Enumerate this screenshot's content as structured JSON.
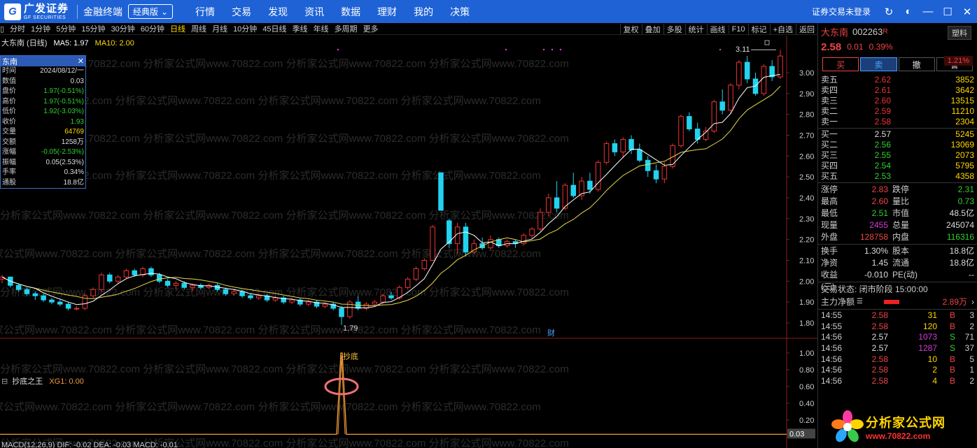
{
  "topbar": {
    "logo_cn": "广发证券",
    "logo_en": "GF SECURITIES",
    "app_name": "金融终端",
    "edition": "经典版",
    "nav": [
      "行情",
      "交易",
      "发现",
      "资讯",
      "数据",
      "理财",
      "我的",
      "决策"
    ],
    "login_status": "证券交易未登录"
  },
  "periodbar": {
    "periods": [
      "分时",
      "1分钟",
      "5分钟",
      "15分钟",
      "30分钟",
      "60分钟",
      "日线",
      "周线",
      "月线",
      "10分钟",
      "45日线",
      "季线",
      "年线",
      "多周期",
      "更多"
    ],
    "active": "日线",
    "tools": [
      "复权",
      "叠加",
      "多股",
      "统计",
      "画线",
      "F10",
      "标记",
      "+自选",
      "返回"
    ]
  },
  "chart_title": {
    "name": "大东南 (日线)",
    "ma5": "MA5: 1.97",
    "ma10": "MA10: 2.00"
  },
  "info_panel": {
    "title": "东南",
    "rows": [
      {
        "label": "时间",
        "value": "2024/08/12/一"
      },
      {
        "label": "数值",
        "value": "0.03"
      },
      {
        "label": "盘价",
        "value": "1.97(-0.51%)"
      },
      {
        "label": "高价",
        "value": "1.97(-0.51%)"
      },
      {
        "label": "低价",
        "value": "1.92(-3.03%)"
      },
      {
        "label": "收价",
        "value": "1.93"
      },
      {
        "label": "交量",
        "value": "64769"
      },
      {
        "label": "交额",
        "value": "1258万"
      },
      {
        "label": "涨幅",
        "value": "-0.05(-2.53%)"
      },
      {
        "label": "振幅",
        "value": "0.05(2.53%)"
      },
      {
        "label": "手率",
        "value": "0.34%"
      },
      {
        "label": "通股",
        "value": "18.8亿"
      }
    ]
  },
  "chart_data": [
    {
      "type": "candlestick",
      "title": "大东南 (日线)",
      "y_ticks": [
        3.0,
        2.9,
        2.8,
        2.7,
        2.6,
        2.5,
        2.4,
        2.3,
        2.2,
        2.1,
        2.0,
        1.9,
        1.8
      ],
      "ylim": [
        1.75,
        3.11
      ],
      "annotations": {
        "high_label": "3.11",
        "low_label": "1.79",
        "marker": "财"
      },
      "candles": [
        [
          2.01,
          2.03,
          1.99,
          2.02
        ],
        [
          2.02,
          2.02,
          1.97,
          1.98
        ],
        [
          1.98,
          1.99,
          1.95,
          1.96
        ],
        [
          1.96,
          1.97,
          1.93,
          1.94
        ],
        [
          1.94,
          1.95,
          1.91,
          1.93
        ],
        [
          1.93,
          1.94,
          1.9,
          1.91
        ],
        [
          1.91,
          1.92,
          1.89,
          1.9
        ],
        [
          1.9,
          1.91,
          1.88,
          1.89
        ],
        [
          1.89,
          1.9,
          1.86,
          1.87
        ],
        [
          1.87,
          1.88,
          1.86,
          1.87
        ],
        [
          1.87,
          1.94,
          1.86,
          1.93
        ],
        [
          1.93,
          1.97,
          1.92,
          1.96
        ],
        [
          1.96,
          2.04,
          1.95,
          2.03
        ],
        [
          2.03,
          2.04,
          1.99,
          2.0
        ],
        [
          2.0,
          2.03,
          1.99,
          2.02
        ],
        [
          2.02,
          2.06,
          2.01,
          2.05
        ],
        [
          2.05,
          2.06,
          2.02,
          2.03
        ],
        [
          2.03,
          2.07,
          2.02,
          2.06
        ],
        [
          2.06,
          2.07,
          2.02,
          2.03
        ],
        [
          2.03,
          2.04,
          1.99,
          2.0
        ],
        [
          2.0,
          2.01,
          1.97,
          1.98
        ],
        [
          1.98,
          2.0,
          1.96,
          1.99
        ],
        [
          1.99,
          2.0,
          1.96,
          1.97
        ],
        [
          1.97,
          1.99,
          1.95,
          1.98
        ],
        [
          1.98,
          1.99,
          1.96,
          1.97
        ],
        [
          1.97,
          1.99,
          1.96,
          1.98
        ],
        [
          1.98,
          1.99,
          1.95,
          1.96
        ],
        [
          1.96,
          1.97,
          1.93,
          1.94
        ],
        [
          1.94,
          1.96,
          1.93,
          1.95
        ],
        [
          1.95,
          1.96,
          1.92,
          1.93
        ],
        [
          1.93,
          1.94,
          1.91,
          1.92
        ],
        [
          1.92,
          1.94,
          1.91,
          1.93
        ],
        [
          1.93,
          1.94,
          1.9,
          1.91
        ],
        [
          1.91,
          1.93,
          1.9,
          1.92
        ],
        [
          1.92,
          1.93,
          1.89,
          1.9
        ],
        [
          1.9,
          1.92,
          1.89,
          1.91
        ],
        [
          1.91,
          1.92,
          1.88,
          1.89
        ],
        [
          1.89,
          1.91,
          1.88,
          1.9
        ],
        [
          1.9,
          1.91,
          1.87,
          1.88
        ],
        [
          1.88,
          1.9,
          1.87,
          1.89
        ],
        [
          1.89,
          1.9,
          1.86,
          1.87
        ],
        [
          1.87,
          1.88,
          1.79,
          1.83
        ],
        [
          1.83,
          1.91,
          1.82,
          1.9
        ],
        [
          1.9,
          1.93,
          1.86,
          1.87
        ],
        [
          1.87,
          1.9,
          1.86,
          1.89
        ],
        [
          1.89,
          1.91,
          1.88,
          1.9
        ],
        [
          1.9,
          1.94,
          1.89,
          1.93
        ],
        [
          1.93,
          1.95,
          1.91,
          1.92
        ],
        [
          1.92,
          1.98,
          1.91,
          1.97
        ],
        [
          1.97,
          2.02,
          1.96,
          2.01
        ],
        [
          2.01,
          2.07,
          2.0,
          2.06
        ],
        [
          2.06,
          2.11,
          2.05,
          2.1
        ],
        [
          2.1,
          2.27,
          2.1,
          2.26
        ],
        [
          2.52,
          2.52,
          2.34,
          2.34
        ],
        [
          2.29,
          2.3,
          2.16,
          2.18
        ],
        [
          2.18,
          2.28,
          2.13,
          2.26
        ],
        [
          2.26,
          2.28,
          2.12,
          2.14
        ],
        [
          2.14,
          2.2,
          2.13,
          2.18
        ],
        [
          2.18,
          2.21,
          2.15,
          2.16
        ],
        [
          2.16,
          2.22,
          2.15,
          2.2
        ],
        [
          2.2,
          2.21,
          2.16,
          2.17
        ],
        [
          2.17,
          2.2,
          2.16,
          2.19
        ],
        [
          2.19,
          2.2,
          2.16,
          2.18
        ],
        [
          2.18,
          2.23,
          2.17,
          2.22
        ],
        [
          2.22,
          2.26,
          2.2,
          2.25
        ],
        [
          2.25,
          2.35,
          2.24,
          2.33
        ],
        [
          2.33,
          2.42,
          2.31,
          2.4
        ],
        [
          2.4,
          2.48,
          2.33,
          2.35
        ],
        [
          2.35,
          2.47,
          2.34,
          2.46
        ],
        [
          2.46,
          2.52,
          2.4,
          2.41
        ],
        [
          2.41,
          2.5,
          2.39,
          2.48
        ],
        [
          2.48,
          2.52,
          2.42,
          2.44
        ],
        [
          2.44,
          2.58,
          2.43,
          2.57
        ],
        [
          2.57,
          2.67,
          2.56,
          2.66
        ],
        [
          2.66,
          2.68,
          2.6,
          2.62
        ],
        [
          2.62,
          2.69,
          2.59,
          2.68
        ],
        [
          2.68,
          2.7,
          2.61,
          2.63
        ],
        [
          2.63,
          2.66,
          2.57,
          2.58
        ],
        [
          2.58,
          2.6,
          2.5,
          2.53
        ],
        [
          2.53,
          2.56,
          2.47,
          2.49
        ],
        [
          2.49,
          2.57,
          2.47,
          2.55
        ],
        [
          2.55,
          2.66,
          2.54,
          2.65
        ],
        [
          2.65,
          2.8,
          2.64,
          2.79
        ],
        [
          2.79,
          2.81,
          2.72,
          2.73
        ],
        [
          2.73,
          2.76,
          2.66,
          2.68
        ],
        [
          2.68,
          2.74,
          2.67,
          2.72
        ],
        [
          2.72,
          2.87,
          2.71,
          2.86
        ],
        [
          2.86,
          2.92,
          2.8,
          2.82
        ],
        [
          2.82,
          2.95,
          2.8,
          2.94
        ],
        [
          2.94,
          3.06,
          2.92,
          3.05
        ],
        [
          3.05,
          3.08,
          2.95,
          2.97
        ],
        [
          2.97,
          3.0,
          2.89,
          2.9
        ],
        [
          2.9,
          3.04,
          2.89,
          3.03
        ],
        [
          3.03,
          3.06,
          2.96,
          2.98
        ],
        [
          2.98,
          3.11,
          2.97,
          3.08
        ]
      ]
    },
    {
      "type": "line",
      "title": "抄底之王",
      "series": [
        {
          "name": "XG1",
          "values": [
            0.03
          ]
        }
      ],
      "y_ticks": [
        1.0,
        0.8,
        0.6,
        0.4,
        0.2
      ],
      "ylim": [
        0,
        1.0
      ],
      "annotations": {
        "signal_label": "抄底",
        "last_value": "0.03",
        "xg1_label": "XG1: 0.00"
      }
    }
  ],
  "indicator_bottom": "MACD(12,26,9)  DIF: -0.02  DEA: -0.03  MACD: -0.01",
  "right_panel": {
    "name": "大东南",
    "code": "002263",
    "flag": "R",
    "sector_btn": "塑料",
    "last": "2.58",
    "change": "0.01",
    "change_pct": "0.39%",
    "pill": "1.21%",
    "actions": [
      "买",
      "卖",
      "撤",
      "警"
    ],
    "asks": [
      {
        "label": "卖五",
        "price": "2.62",
        "vol": "3852"
      },
      {
        "label": "卖四",
        "price": "2.61",
        "vol": "3642"
      },
      {
        "label": "卖三",
        "price": "2.60",
        "vol": "13515"
      },
      {
        "label": "卖二",
        "price": "2.59",
        "vol": "11210"
      },
      {
        "label": "卖一",
        "price": "2.58",
        "vol": "2304"
      }
    ],
    "bids": [
      {
        "label": "买一",
        "price": "2.57",
        "vol": "5245"
      },
      {
        "label": "买二",
        "price": "2.56",
        "vol": "13069"
      },
      {
        "label": "买三",
        "price": "2.55",
        "vol": "2073"
      },
      {
        "label": "买四",
        "price": "2.54",
        "vol": "5795"
      },
      {
        "label": "买五",
        "price": "2.53",
        "vol": "4358"
      }
    ],
    "stats": [
      {
        "l1": "涨停",
        "v1": "2.83",
        "c1": "red",
        "l2": "跌停",
        "v2": "2.31",
        "c2": "green"
      },
      {
        "l1": "最高",
        "v1": "2.60",
        "c1": "red",
        "l2": "量比",
        "v2": "0.73",
        "c2": "green"
      },
      {
        "l1": "最低",
        "v1": "2.51",
        "c1": "green",
        "l2": "市值",
        "v2": "48.5亿",
        "c2": "white"
      },
      {
        "l1": "现量",
        "v1": "2455",
        "c1": "purple",
        "l2": "总量",
        "v2": "245074",
        "c2": "white"
      },
      {
        "l1": "外盘",
        "v1": "128758",
        "c1": "red",
        "l2": "内盘",
        "v2": "116316",
        "c2": "green"
      }
    ],
    "stats2": [
      {
        "l1": "换手",
        "v1": "1.30%",
        "c1": "white",
        "l2": "股本",
        "v2": "18.8亿",
        "c2": "white"
      },
      {
        "l1": "净资",
        "v1": "1.45",
        "c1": "white",
        "l2": "流通",
        "v2": "18.8亿",
        "c2": "white"
      },
      {
        "l1": "收益(三)",
        "v1": "-0.010",
        "c1": "white",
        "l2": "PE(动)",
        "v2": "--",
        "c2": "white"
      }
    ],
    "trade_status": "交易状态: 闭市阶段 15:00:00",
    "netflow_label": "主力净额",
    "netflow_value": "2.89万",
    "ticks": [
      {
        "t": "14:55",
        "p": "2.58",
        "pc": "red",
        "v": "31",
        "vc": "yellow",
        "s": "B",
        "sc": "red",
        "n": "3"
      },
      {
        "t": "14:55",
        "p": "2.58",
        "pc": "red",
        "v": "120",
        "vc": "yellow",
        "s": "B",
        "sc": "red",
        "n": "2"
      },
      {
        "t": "14:56",
        "p": "2.57",
        "pc": "white",
        "v": "1073",
        "vc": "purple",
        "s": "S",
        "sc": "green",
        "n": "71"
      },
      {
        "t": "14:56",
        "p": "2.57",
        "pc": "white",
        "v": "1287",
        "vc": "purple",
        "s": "S",
        "sc": "green",
        "n": "37"
      },
      {
        "t": "14:56",
        "p": "2.58",
        "pc": "red",
        "v": "10",
        "vc": "yellow",
        "s": "B",
        "sc": "red",
        "n": "5"
      },
      {
        "t": "14:56",
        "p": "2.58",
        "pc": "red",
        "v": "2",
        "vc": "yellow",
        "s": "B",
        "sc": "red",
        "n": "1"
      },
      {
        "t": "14:56",
        "p": "2.58",
        "pc": "red",
        "v": "4",
        "vc": "yellow",
        "s": "B",
        "sc": "red",
        "n": "2"
      }
    ]
  },
  "watermark": {
    "text": "分析家公式网www.70822.com 分析家公式网www.70822.com 分析家公式网www.70822.com 分析家公式网www.70822.com",
    "logo_cn": "分析家公式网",
    "logo_url": "www.70822.com"
  },
  "colors": {
    "up": "#ee3333",
    "down": "#22d3f0",
    "ma5": "#ffffff",
    "ma10": "#e8d84a",
    "indicator": "#f39a3a",
    "circle": "#f07070"
  }
}
